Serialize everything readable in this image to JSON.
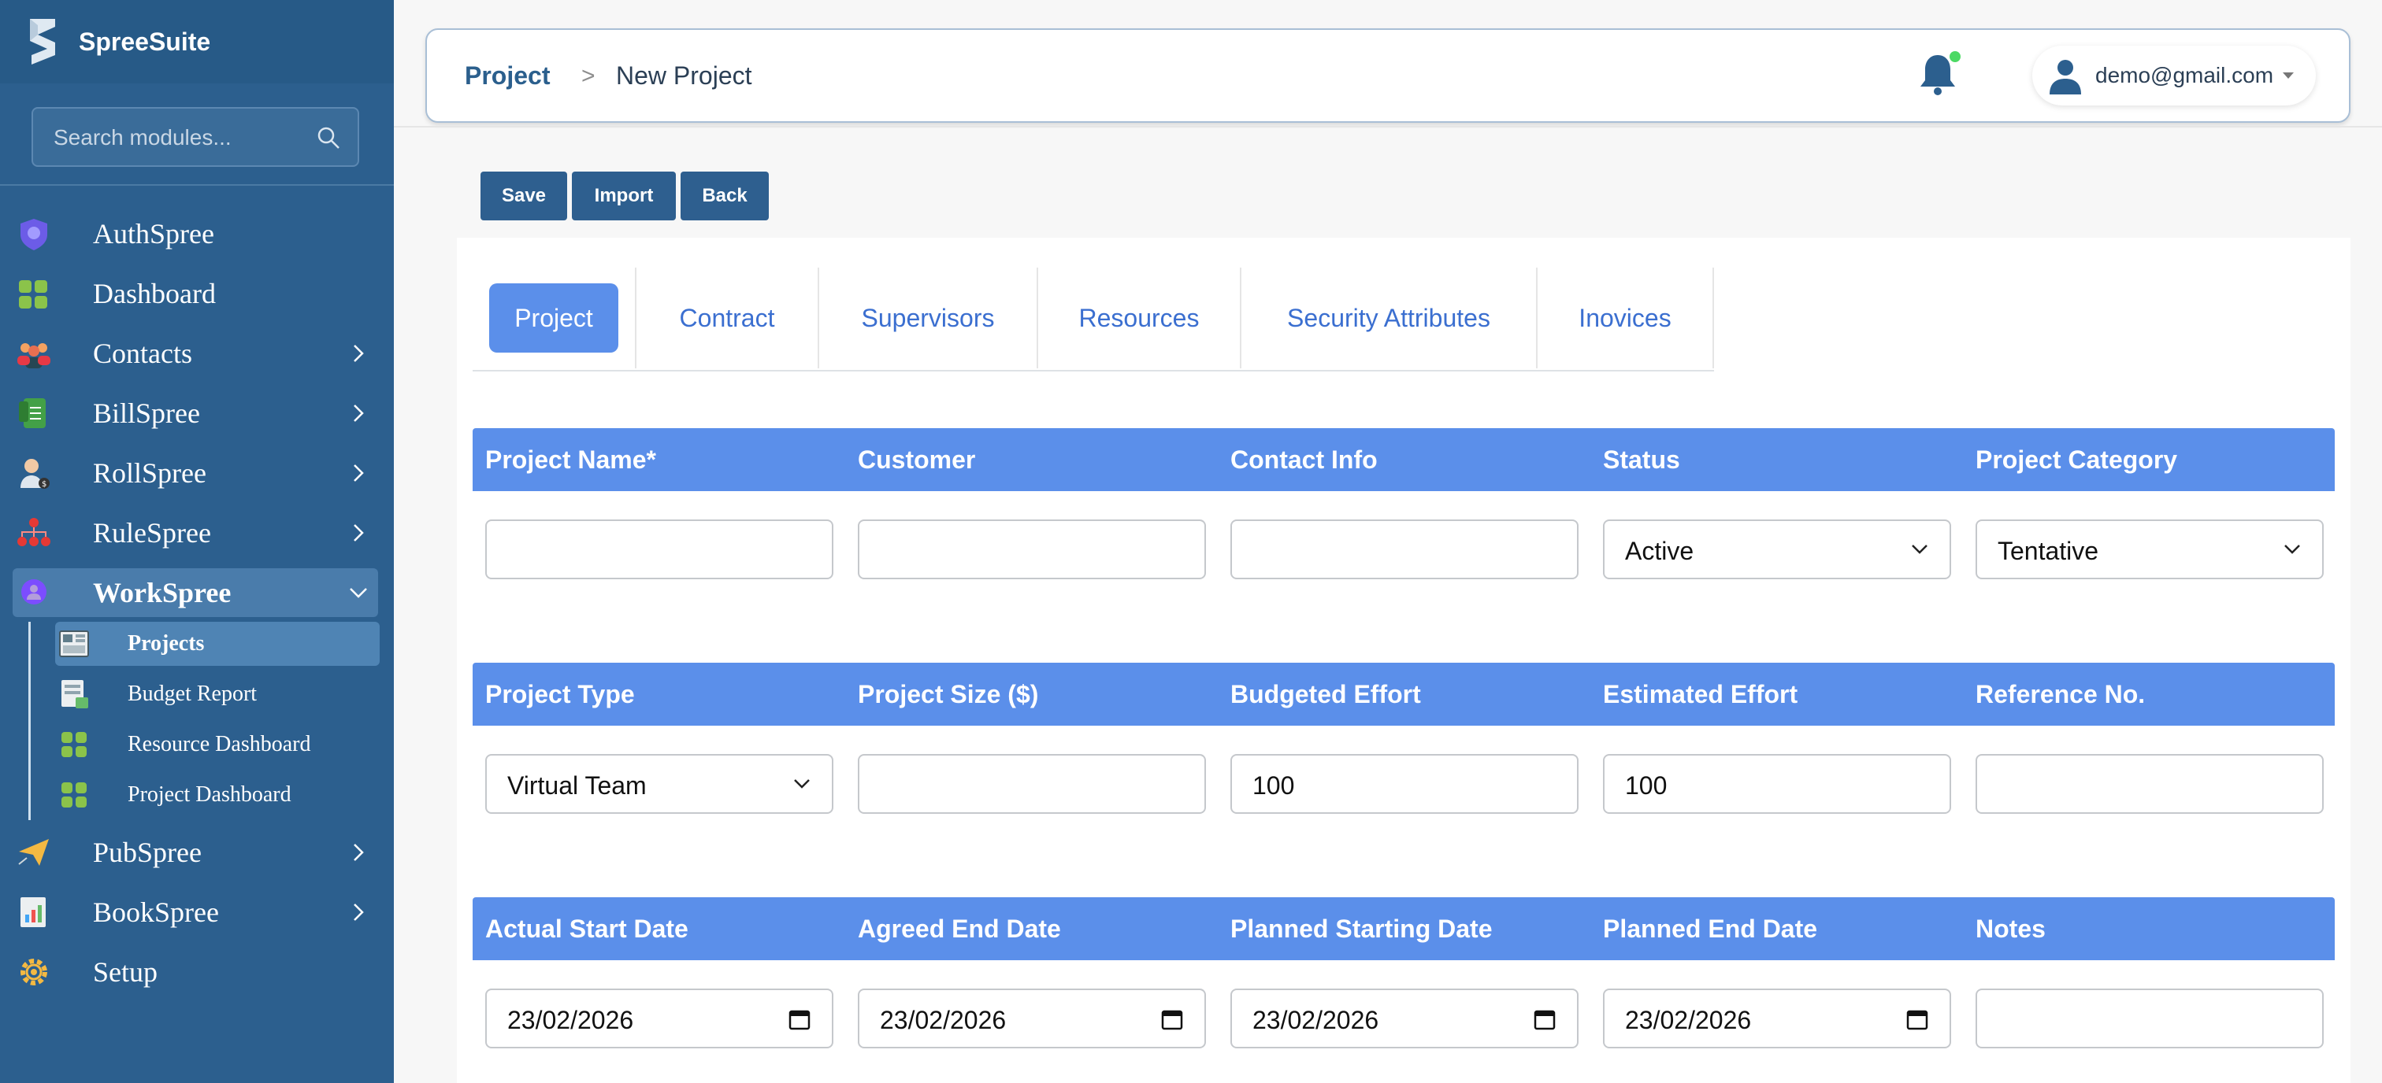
{
  "app": {
    "name": "SpreeSuite"
  },
  "search": {
    "placeholder": "Search modules..."
  },
  "sidebar": {
    "items": [
      {
        "label": "AuthSpree"
      },
      {
        "label": "Dashboard"
      },
      {
        "label": "Contacts"
      },
      {
        "label": "BillSpree"
      },
      {
        "label": "RollSpree"
      },
      {
        "label": "RuleSpree"
      },
      {
        "label": "WorkSpree"
      },
      {
        "label": "PubSpree"
      },
      {
        "label": "BookSpree"
      },
      {
        "label": "Setup"
      }
    ],
    "sub_items": [
      {
        "label": "Projects"
      },
      {
        "label": "Budget Report"
      },
      {
        "label": "Resource Dashboard"
      },
      {
        "label": "Project Dashboard"
      }
    ]
  },
  "breadcrumb": {
    "root": "Project",
    "separator": ">",
    "current": "New Project"
  },
  "user": {
    "email": "demo@gmail.com"
  },
  "toolbar": {
    "save": "Save",
    "import": "Import",
    "back": "Back"
  },
  "tabs": [
    "Project",
    "Contract",
    "Supervisors",
    "Resources",
    "Security Attributes",
    "Inovices"
  ],
  "form": {
    "row1": {
      "headers": [
        "Project Name*",
        "Customer",
        "Contact Info",
        "Status",
        "Project Category"
      ],
      "status": "Active",
      "category": "Tentative"
    },
    "row2": {
      "headers": [
        "Project Type",
        "Project Size ($)",
        "Budgeted Effort",
        "Estimated Effort",
        "Reference No."
      ],
      "type": "Virtual Team",
      "budgeted_effort": "100",
      "estimated_effort": "100"
    },
    "row3": {
      "headers": [
        "Actual Start Date",
        "Agreed End Date",
        "Planned Starting Date",
        "Planned End Date",
        "Notes"
      ],
      "actual_start": "23/02/2026",
      "agreed_end": "23/02/2026",
      "planned_start": "23/02/2026",
      "planned_end": "23/02/2026"
    }
  },
  "colors": {
    "sidebar_bg": "#2c5f8e",
    "header_row_bg": "#5b8fea",
    "button_bg": "#2e5f8f",
    "tab_text": "#3b6fd0",
    "notification_dot": "#4cd964"
  },
  "icons": {
    "brand": "spreesuite-s-logo",
    "search": "search-icon",
    "bell": "bell-icon",
    "user": "user-icon"
  }
}
